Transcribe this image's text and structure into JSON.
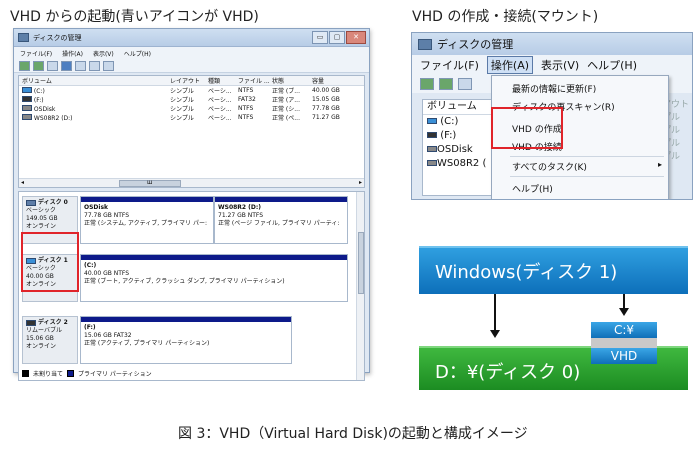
{
  "left_heading": "VHD からの起動(青いアイコンが VHD)",
  "right_heading": "VHD の作成・接続(マウント)",
  "caption": "図 3：VHD（Virtual Hard Disk)の起動と構成イメージ",
  "left_window": {
    "title": "ディスクの管理",
    "controls": [
      "▭",
      "▢",
      "✕"
    ],
    "menu": [
      "ファイル(F)",
      "操作(A)",
      "表示(V)",
      "ヘルプ(H)"
    ],
    "volume_table": {
      "headers": [
        "ボリューム",
        "レイアウト",
        "種類",
        "ファイル ...",
        "状態",
        "容量"
      ],
      "rows": [
        [
          "(C:)",
          "シンプル",
          "ベーシ...",
          "NTFS",
          "正常 (ブ...",
          "40.00 GB"
        ],
        [
          "(F:)",
          "シンプル",
          "ベーシ...",
          "FAT32",
          "正常 (ア...",
          "15.05 GB"
        ],
        [
          "OSDisk",
          "シンプル",
          "ベーシ...",
          "NTFS",
          "正常 (シ...",
          "77.78 GB"
        ],
        [
          "WS08R2 (D:)",
          "シンプル",
          "ベーシ...",
          "NTFS",
          "正常 (ペ...",
          "71.27 GB"
        ]
      ],
      "scroll_mark": "ш"
    },
    "disks": [
      {
        "name": "ディスク 0",
        "type": "ベーシック",
        "size": "149.05 GB",
        "status": "オンライン",
        "partitions": [
          {
            "name": "OSDisk",
            "size": "77.78 GB NTFS",
            "status": "正常 (システム, アクティブ, プライマリ パー:"
          },
          {
            "name": "WS08R2  (D:)",
            "size": "71.27 GB NTFS",
            "status": "正常 (ページ ファイル, プライマリ パーティ:"
          }
        ]
      },
      {
        "name": "ディスク 1",
        "type": "ベーシック",
        "size": "40.00 GB",
        "status": "オンライン",
        "partitions": [
          {
            "name": "(C:)",
            "size": "40.00 GB NTFS",
            "status": "正常 (ブート, アクティブ, クラッシュ ダンプ, プライマリ パーティション)"
          }
        ]
      },
      {
        "name": "ディスク 2",
        "type": "リムーバブル",
        "size": "15.06 GB",
        "status": "オンライン",
        "partitions": [
          {
            "name": "(F:)",
            "size": "15.06 GB FAT32",
            "status": "正常 (アクティブ, プライマリ パーティション)"
          }
        ]
      }
    ],
    "legend": [
      "未割り当て",
      "プライマリ パーティション"
    ]
  },
  "right_window": {
    "title": "ディスクの管理",
    "menu": [
      "ファイル(F)",
      "操作(A)",
      "表示(V)",
      "ヘルプ(H)"
    ],
    "volume_header": "ボリューム",
    "volumes": [
      "(C:)",
      "(F:)",
      "OSDisk",
      "WS08R2 ("
    ],
    "side_fragments": [
      "アウト",
      "プル",
      "プル",
      "プル",
      "プル"
    ],
    "dropdown": {
      "refresh": "最新の情報に更新(F)",
      "rescan": "ディスクの再スキャン(R)",
      "create_vhd": "VHD の作成",
      "attach_vhd": "VHD の接続",
      "all_tasks": "すべてのタスク(K)",
      "all_tasks_arrow": "▸",
      "help": "ヘルプ(H)"
    }
  },
  "diagram": {
    "top_label": "Windows(ディスク 1)",
    "bottom_label": "D：¥(ディスク 0)",
    "vhd_top": "C:¥",
    "vhd_bottom": "VHD",
    "colors": {
      "blue": "#0d6fba",
      "green": "#1c8c22",
      "red_highlight": "#e0242a",
      "primary_bar": "#0d1a8a"
    }
  }
}
